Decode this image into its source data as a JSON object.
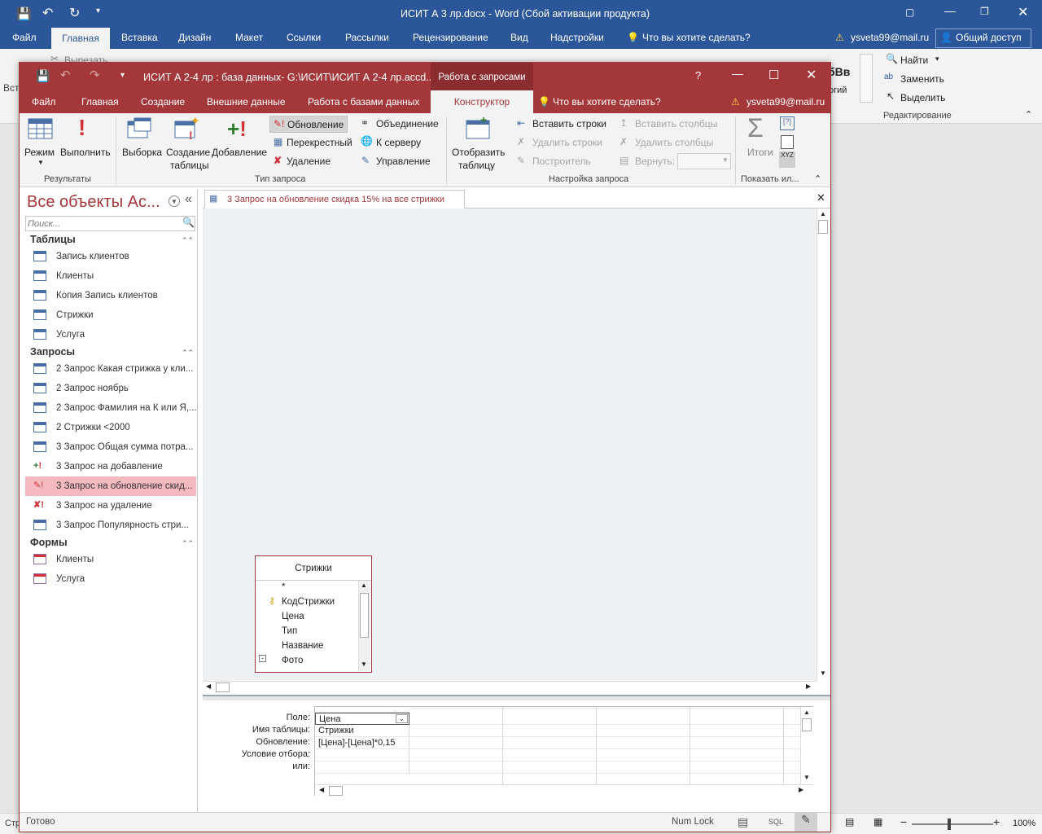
{
  "word": {
    "title": "ИСИТ А 3 лр.docx - Word (Сбой активации продукта)",
    "tabs": [
      "Файл",
      "Главная",
      "Вставка",
      "Дизайн",
      "Макет",
      "Ссылки",
      "Рассылки",
      "Рецензирование",
      "Вид",
      "Надстройки"
    ],
    "tell_me": "Что вы хотите сделать?",
    "user": "ysveta99@mail.ru",
    "share": "Общий доступ",
    "ribbon": {
      "cut": "Вырезать",
      "find": "Найти",
      "replace": "Заменить",
      "select": "Выделить",
      "editing_group": "Редактирование",
      "style_preview": "бВв",
      "style_partial": "огий",
      "paste_partial": "Вст"
    },
    "status": {
      "left": "Стр",
      "zoom": "100%"
    }
  },
  "access": {
    "title": "ИСИТ А 2-4 лр : база данных- G:\\ИСИТ\\ИСИТ А 2-4 лр.accd...",
    "context_tab": "Работа с запросами",
    "help": "?",
    "tabs": [
      "Файл",
      "Главная",
      "Создание",
      "Внешние данные",
      "Работа с базами данных"
    ],
    "active_tab": "Конструктор",
    "tell_me": "Что вы хотите сделать?",
    "user": "ysveta99@mail.ru",
    "ribbon": {
      "mode": "Режим",
      "run": "Выполнить",
      "results_group": "Результаты",
      "select": "Выборка",
      "make_table_1": "Создание",
      "make_table_2": "таблицы",
      "append": "Добавление",
      "update": "Обновление",
      "crosstab": "Перекрестный",
      "delete": "Удаление",
      "union": "Объединение",
      "passthrough": "К серверу",
      "ddl": "Управление",
      "query_type_group": "Тип запроса",
      "show_table_1": "Отобразить",
      "show_table_2": "таблицу",
      "insert_rows": "Вставить строки",
      "delete_rows": "Удалить строки",
      "builder": "Построитель",
      "insert_cols": "Вставить столбцы",
      "delete_cols": "Удалить столбцы",
      "return": "Вернуть:",
      "setup_group": "Настройка запроса",
      "totals": "Итоги",
      "show_hide_group": "Показать ил..."
    },
    "nav": {
      "title": "Все объекты Ac...",
      "search_placeholder": "Поиск...",
      "sections": [
        {
          "name": "Таблицы",
          "items": [
            "Запись клиентов",
            "Клиенты",
            "Копия Запись клиентов",
            "Стрижки",
            "Услуга"
          ]
        },
        {
          "name": "Запросы",
          "items": [
            "2 Запрос Какая стрижка у кли...",
            "2 Запрос ноябрь",
            "2 Запрос Фамилия на К или Я,...",
            "2 Стрижки <2000",
            "3 Запрос Общая сумма потра...",
            "3 Запрос на добавление",
            "3 Запрос на обновление скид...",
            "3 Запрос на удаление",
            "3 Запрос Популярность стри..."
          ]
        },
        {
          "name": "Формы",
          "items": [
            "Клиенты",
            "Услуга"
          ]
        }
      ]
    },
    "query_tab": "3 Запрос на обновление скидка 15% на все стрижки",
    "table_box": {
      "title": "Стрижки",
      "fields": [
        "*",
        "КодСтрижки",
        "Цена",
        "Тип",
        "Название",
        "Фото"
      ]
    },
    "grid": {
      "labels": [
        "Поле:",
        "Имя таблицы:",
        "Обновление:",
        "Условие отбора:",
        "или:"
      ],
      "col1": [
        "Цена",
        "Стрижки",
        "[Цена]-[Цена]*0,15",
        "",
        ""
      ]
    },
    "status": {
      "left": "Готово",
      "numlock": "Num Lock",
      "sql": "SQL"
    }
  }
}
